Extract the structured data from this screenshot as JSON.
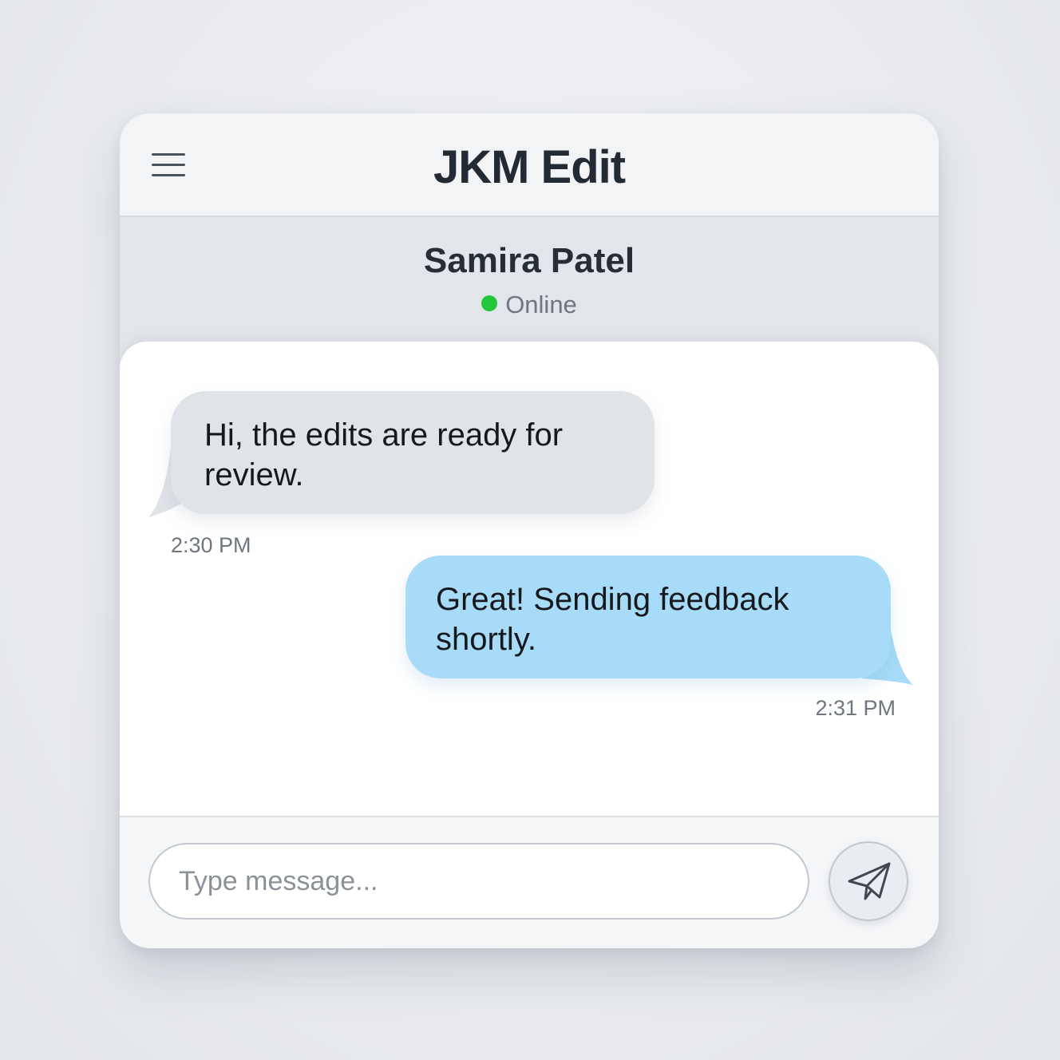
{
  "app": {
    "title": "JKM Edit"
  },
  "contact": {
    "name": "Samira Patel",
    "status": "Online",
    "status_color": "#22c73a"
  },
  "messages": [
    {
      "direction": "incoming",
      "text": "Hi, the edits are ready for review.",
      "time": "2:30 PM",
      "bubble_color": "#e0e3e8"
    },
    {
      "direction": "outgoing",
      "text": "Great! Sending feedback shortly.",
      "time": "2:31 PM",
      "bubble_color": "#a7dbf7"
    }
  ],
  "composer": {
    "placeholder": "Type message...",
    "value": "",
    "send_icon": "paper-plane-icon"
  },
  "icons": {
    "menu": "hamburger-menu-icon"
  }
}
